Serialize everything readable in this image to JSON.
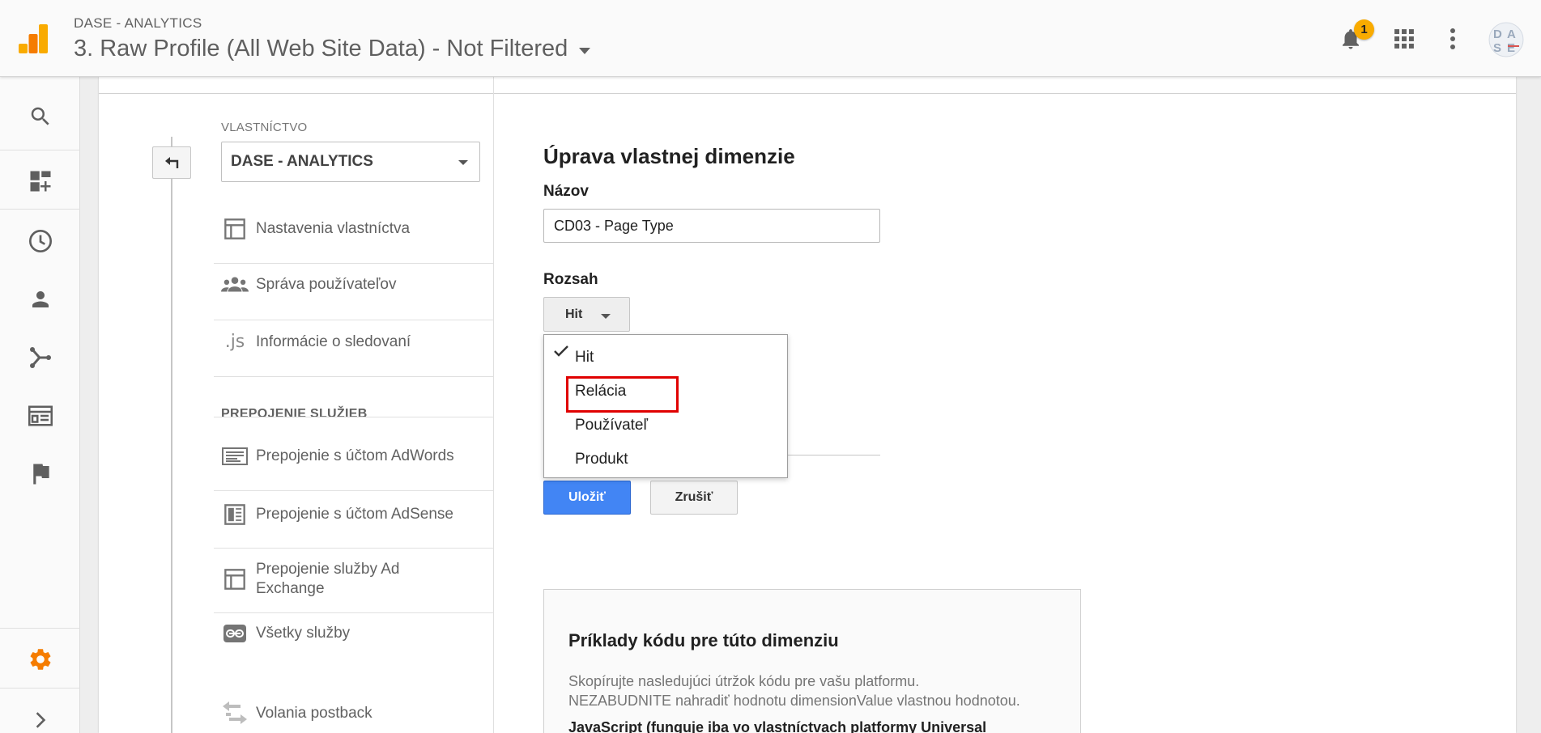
{
  "header": {
    "account_name": "DASE - ANALYTICS",
    "profile_name": "3. Raw Profile (All Web Site Data) - Not Filtered",
    "notification_count": "1",
    "avatar_text": "DASE"
  },
  "rail": {
    "items": [
      "search-icon",
      "customization-icon",
      "realtime-icon",
      "audience-icon",
      "acquisition-icon",
      "behavior-icon",
      "conversions-icon",
      "admin-gear-icon",
      "expand-chevron-icon"
    ]
  },
  "admin": {
    "column_label": "VLASTNÍCTVO",
    "property_selected": "DASE - ANALYTICS",
    "items": [
      "Nastavenia vlastníctva",
      "Správa používateľov",
      "Informácie o sledovaní"
    ],
    "section_head": "PREPOJENIE SLUŽIEB",
    "links": [
      "Prepojenie s účtom AdWords",
      "Prepojenie s účtom AdSense",
      "Prepojenie služby Ad Exchange",
      "Všetky služby",
      "Volania postback"
    ]
  },
  "form": {
    "title": "Úprava vlastnej dimenzie",
    "name_label": "Názov",
    "name_value": "CD03 - Page Type",
    "scope_label": "Rozsah",
    "scope_selected": "Hit",
    "scope_options": [
      "Hit",
      "Relácia",
      "Používateľ",
      "Produkt"
    ],
    "save_label": "Uložiť",
    "cancel_label": "Zrušiť"
  },
  "code_examples": {
    "title": "Príklady kódu pre túto dimenziu",
    "line1": "Skopírujte nasledujúci útržok kódu pre vašu platformu.",
    "line2": "NEZABUDNITE nahradiť hodnotu dimensionValue vlastnou hodnotou.",
    "lang": "JavaScript (funguje iba vo vlastníctvach platformy Universal"
  },
  "colors": {
    "accent_blue": "#4285f4",
    "highlight_red": "#e00000",
    "badge_yellow": "#f9ab00",
    "gear_orange": "#f57c00"
  }
}
